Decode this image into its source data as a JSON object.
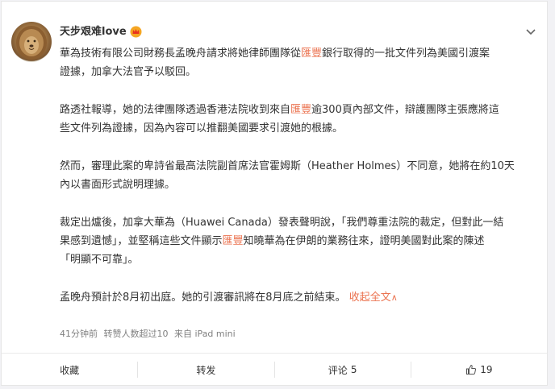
{
  "post": {
    "author": "天步艰难love",
    "paragraphs": [
      [
        {
          "t": "華為技術有限公司財務長孟晚舟請求將她律師團隊從"
        },
        {
          "t": "匯豐",
          "hl": true
        },
        {
          "t": "銀行取得的一批文件列為美國引渡案"
        },
        {
          "br": true
        },
        {
          "t": "證據，加拿大法官予以駁回。"
        }
      ],
      [
        {
          "t": "路透社報導，她的法律團隊透過香港法院收到來自"
        },
        {
          "t": "匯豐",
          "hl": true
        },
        {
          "t": "逾300頁內部文件，辯護團隊主張應將這"
        },
        {
          "br": true
        },
        {
          "t": "些文件列為證據，因為內容可以推翻美國要求引渡她的根據。"
        }
      ],
      [
        {
          "t": "然而，審理此案的卑詩省最高法院副首席法官霍姆斯（Heather Holmes）不同意，她將在約10天"
        },
        {
          "br": true
        },
        {
          "t": "內以書面形式說明理據。"
        }
      ],
      [
        {
          "t": "裁定出爐後，加拿大華為（Huawei Canada）發表聲明說，「我們尊重法院的裁定，但對此一結"
        },
        {
          "br": true
        },
        {
          "t": "果感到遺憾」，並堅稱這些文件顯示"
        },
        {
          "t": "匯豐",
          "hl": true
        },
        {
          "t": "知曉華為在伊朗的業務往來，證明美國對此案的陳述"
        },
        {
          "br": true
        },
        {
          "t": "「明顯不可靠」。"
        }
      ],
      [
        {
          "t": "孟晚舟預計於8月初出庭。她的引渡審訊將在8月底之前結束。"
        }
      ]
    ],
    "collapse_label": "收起全文",
    "time": "41分钟前",
    "reposts_note": "转赞人数超过10",
    "source": "来自 iPad mini"
  },
  "actions": {
    "favorite": "收藏",
    "repost": "转发",
    "comment_label": "评论",
    "comment_count": "5",
    "like_count": "19"
  },
  "colors": {
    "highlight": "#eb7350",
    "meta": "#808080",
    "text": "#333333"
  },
  "icons": {
    "crown": "crown-icon",
    "expand": "chevron-down-icon",
    "like": "thumbs-up-icon",
    "collapse_caret": "caret-up-icon"
  }
}
